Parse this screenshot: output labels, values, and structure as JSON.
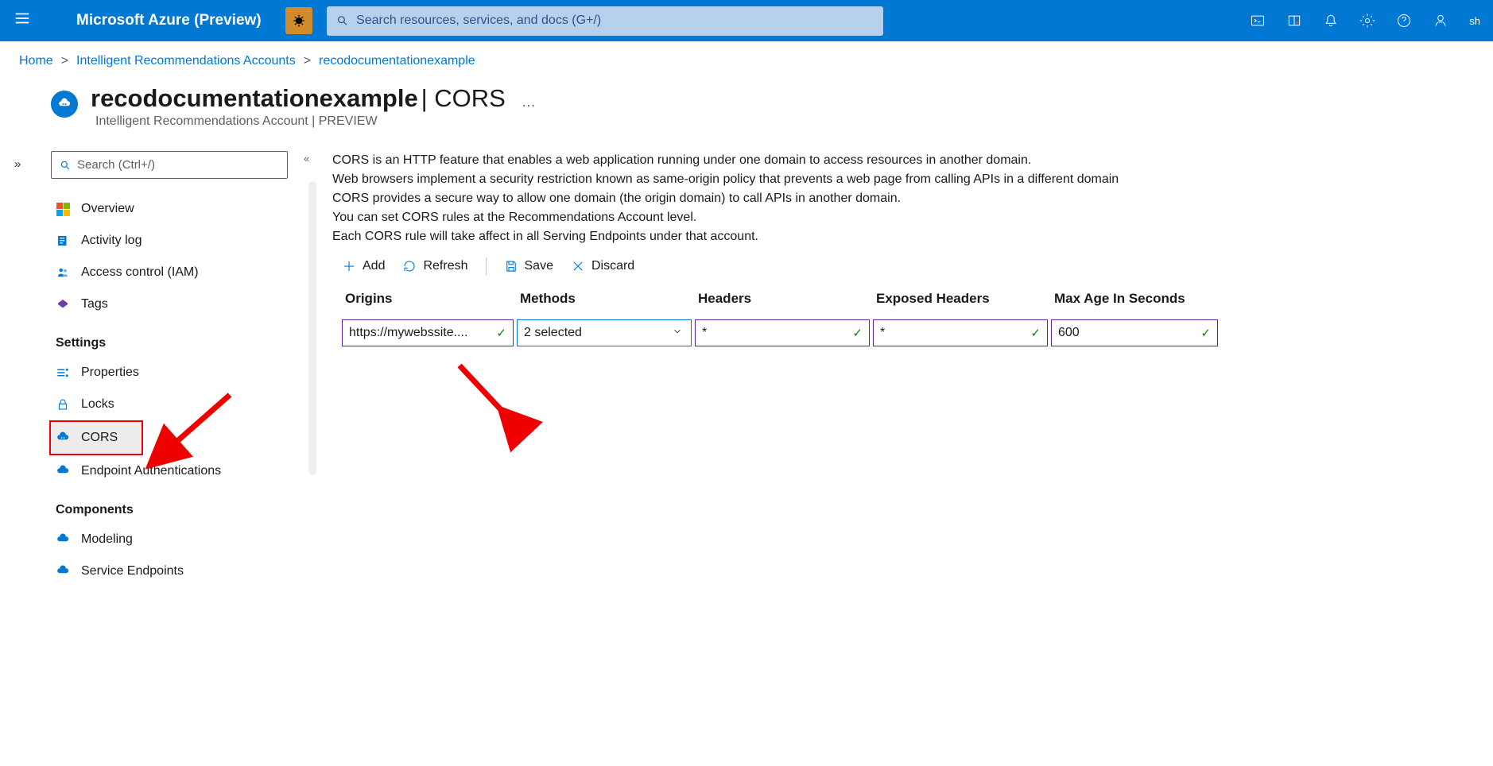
{
  "brand": "Microsoft Azure (Preview)",
  "search": {
    "placeholder": "Search resources, services, and docs (G+/)"
  },
  "user_initials": "sh",
  "breadcrumb": {
    "items": [
      "Home",
      "Intelligent Recommendations Accounts",
      "recodocumentationexample"
    ]
  },
  "header": {
    "resource_name": "recodocumentationexample",
    "blade_name": "CORS",
    "subtitle": "Intelligent Recommendations Account | PREVIEW",
    "more": "…"
  },
  "sidebar": {
    "search_placeholder": "Search (Ctrl+/)",
    "items_top": [
      {
        "icon": "overview",
        "label": "Overview"
      },
      {
        "icon": "activity",
        "label": "Activity log"
      },
      {
        "icon": "iam",
        "label": "Access control (IAM)"
      },
      {
        "icon": "tags",
        "label": "Tags"
      }
    ],
    "group_settings": "Settings",
    "items_settings": [
      {
        "icon": "properties",
        "label": "Properties"
      },
      {
        "icon": "locks",
        "label": "Locks"
      },
      {
        "icon": "cors",
        "label": "CORS",
        "selected": true
      },
      {
        "icon": "endpoint-auth",
        "label": "Endpoint Authentications"
      }
    ],
    "group_components": "Components",
    "items_components": [
      {
        "icon": "modeling",
        "label": "Modeling"
      },
      {
        "icon": "service-endpoints",
        "label": "Service Endpoints"
      }
    ]
  },
  "main": {
    "desc": [
      "CORS is an HTTP feature that enables a web application running under one domain to access resources in another domain.",
      "Web browsers implement a security restriction known as same-origin policy that prevents a web page from calling APIs in a different domain",
      "CORS provides a secure way to allow one domain (the origin domain) to call APIs in another domain.",
      "You can set CORS rules at the Recommendations Account level.",
      "Each CORS rule will take affect in all Serving Endpoints under that account."
    ],
    "toolbar": {
      "add": "Add",
      "refresh": "Refresh",
      "save": "Save",
      "discard": "Discard"
    },
    "table": {
      "headers": [
        "Origins",
        "Methods",
        "Headers",
        "Exposed Headers",
        "Max Age In Seconds"
      ],
      "row": {
        "origin": "https://mywebssite....",
        "methods": "2 selected",
        "headers": "*",
        "exposed": "*",
        "maxage": "600"
      }
    }
  }
}
